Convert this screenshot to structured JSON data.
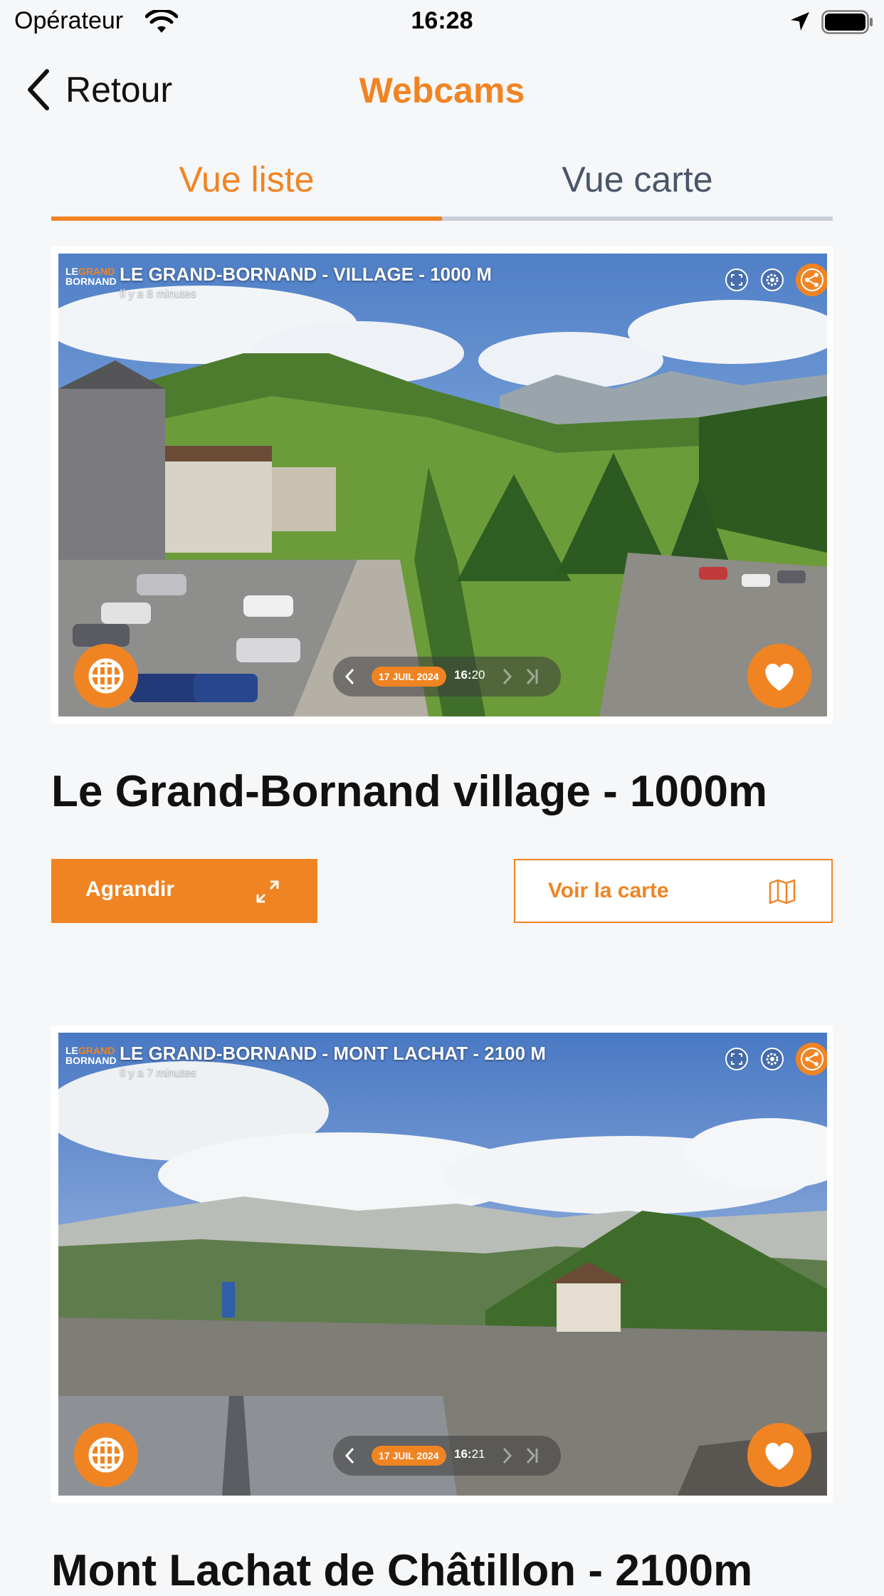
{
  "status_bar": {
    "carrier": "Opérateur",
    "time": "16:28"
  },
  "nav": {
    "back_label": "Retour",
    "title": "Webcams"
  },
  "tabs": [
    {
      "label": "Vue liste",
      "active": true
    },
    {
      "label": "Vue carte",
      "active": false
    }
  ],
  "colors": {
    "accent": "#f08423",
    "background": "#f6f7f9",
    "inactive_tab": "#4a5568"
  },
  "webcams": [
    {
      "overlay_title": "LE GRAND-BORNAND - VILLAGE - 1000 M",
      "overlay_subtitle": "Il y a 8 minutes",
      "date": "17 JUIL 2024",
      "time_hour": "16:",
      "time_min": "20",
      "title": "Le Grand-Bornand village - 1000m",
      "primary_button": "Agrandir",
      "secondary_button": "Voir la carte"
    },
    {
      "overlay_title": "LE GRAND-BORNAND - MONT LACHAT - 2100 M",
      "overlay_subtitle": "Il y a 7 minutes",
      "date": "17 JUIL 2024",
      "time_hour": "16:",
      "time_min": "21",
      "title": "Mont Lachat de Châtillon - 2100m"
    }
  ],
  "brand": {
    "line1": "LE",
    "line1_accent": "GRAND",
    "line2": "BORNAND"
  },
  "icons": [
    "wifi-icon",
    "location-arrow-icon",
    "battery-icon",
    "chevron-left-icon",
    "fullscreen-icon",
    "settings-icon",
    "share-icon",
    "panorama-grid-icon",
    "heart-icon",
    "expand-icon",
    "map-icon"
  ]
}
